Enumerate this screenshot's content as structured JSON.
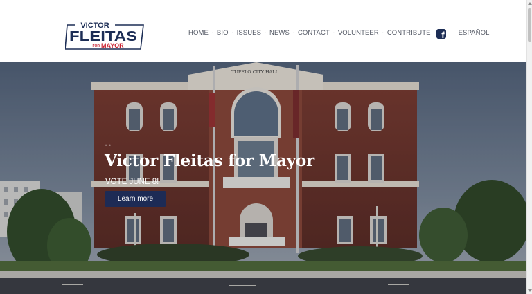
{
  "logo": {
    "line1": "VICTOR",
    "line2": "FLEITAS",
    "line3_small": "FOR",
    "line3_big": "MAYOR",
    "colors": {
      "navy": "#1c2d55",
      "red": "#c8202f"
    }
  },
  "nav": {
    "items": [
      {
        "label": "HOME"
      },
      {
        "label": "BIO"
      },
      {
        "label": "ISSUES"
      },
      {
        "label": "NEWS"
      },
      {
        "label": "CONTACT"
      },
      {
        "label": "VOLUNTEER"
      },
      {
        "label": "CONTRIBUTE"
      }
    ],
    "facebook_icon": "facebook-icon",
    "espanol": "ESPAÑOL"
  },
  "hero": {
    "sign": "TUPELO CITY HALL",
    "dots": "• •",
    "title": "Victor Fleitas for Mayor",
    "subtitle": "VOTE JUNE 8!",
    "button": "Learn more",
    "button_color": "#1d2b55"
  }
}
